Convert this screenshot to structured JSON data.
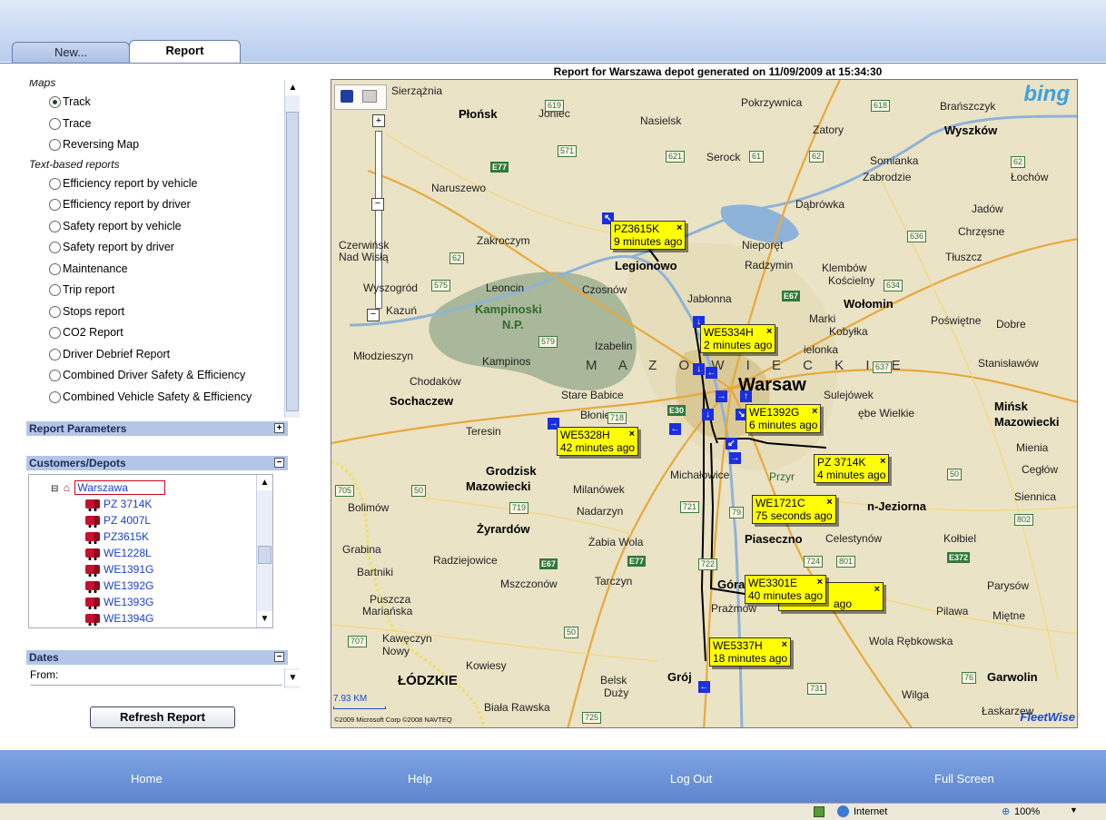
{
  "tabs": [
    {
      "label": "New..."
    },
    {
      "label": "Report"
    }
  ],
  "report_options": {
    "section_maps_label": "Maps",
    "maps": [
      {
        "label": "Track",
        "selected": true
      },
      {
        "label": "Trace",
        "selected": false
      },
      {
        "label": "Reversing Map",
        "selected": false
      }
    ],
    "section_text_label": "Text-based reports",
    "text_reports": [
      {
        "label": "Efficiency report by vehicle"
      },
      {
        "label": "Efficiency report by driver"
      },
      {
        "label": "Safety report by vehicle"
      },
      {
        "label": "Safety report by driver"
      },
      {
        "label": "Maintenance"
      },
      {
        "label": "Trip report"
      },
      {
        "label": "Stops report"
      },
      {
        "label": "CO2 Report"
      },
      {
        "label": "Driver Debrief Report"
      },
      {
        "label": "Combined Driver Safety & Efficiency"
      },
      {
        "label": "Combined Vehicle Safety & Efficiency"
      }
    ]
  },
  "sections": {
    "report_parameters": "Report Parameters",
    "customers_depots": "Customers/Depots",
    "dates": "Dates",
    "from_label": "From:",
    "expand_symbol": "+",
    "collapse_symbol": "−"
  },
  "depot_tree": {
    "depot": "Warszawa",
    "vehicles": [
      "PZ 3714K",
      "PZ 4007L",
      "PZ3615K",
      "WE1228L",
      "WE1391G",
      "WE1392G",
      "WE1393G",
      "WE1394G"
    ]
  },
  "refresh_button": "Refresh Report",
  "map": {
    "title": "Report for Warszawa depot generated on 11/09/2009 at 15:34:30",
    "brand": "bing",
    "footer_brand": "FleetWise",
    "scale": "7.93 KM",
    "copyright": "©2009 Microsoft Corp ©2008 NAVTEQ",
    "callouts": [
      {
        "vehicle": "PZ3615K",
        "time": "9 minutes ago"
      },
      {
        "vehicle": "WE5334H",
        "time": "2 minutes ago"
      },
      {
        "vehicle": "WE1392G",
        "time": "6 minutes ago"
      },
      {
        "vehicle": "WE5328H",
        "time": "42 minutes ago"
      },
      {
        "vehicle": "PZ 3714K",
        "time": "4 minutes ago"
      },
      {
        "vehicle": "WE1721C",
        "time": "75 seconds ago"
      },
      {
        "vehicle": "WE3301E",
        "time": "40 minutes ago"
      },
      {
        "vehicle": "",
        "time": "ago"
      },
      {
        "vehicle": "WE5337H",
        "time": "18 minutes ago"
      }
    ],
    "close_symbol": "×",
    "places": {
      "warsaw": "Warsaw",
      "plonsk": "Płońsk",
      "legionowo": "Legionowo",
      "wolomin": "Wołomin",
      "wyszkow": "Wyszków",
      "sochaczew": "Sochaczew",
      "grodzisk": "Grodzisk",
      "mazowiecki": "Mazowiecki",
      "zyrardow": "Żyrardów",
      "minsk": "Mińsk",
      "minsk2": "Mazowiecki",
      "garwolin": "Garwolin",
      "lodzkie": "ŁÓDZKIE",
      "mazowsze": "M A Z O W I E C K I E",
      "kampinoski": "Kampinoski",
      "np": "N.P.",
      "piaseczno": "Piaseczno",
      "jeziorna": "n-Jeziorna",
      "naruszewo": "Naruszewo",
      "joniec": "Joniec",
      "nasielsk": "Nasielsk",
      "pokrzywnica": "Pokrzywnica",
      "branszczyk": "Brańszczyk",
      "zatory": "Zatory",
      "serock": "Serock",
      "somianka": "Somianka",
      "zabrodzie": "Zabrodzie",
      "lochow": "Łochów",
      "dabrowka": "Dąbrówka",
      "jadow": "Jadów",
      "zakroczym": "Zakroczym",
      "nieporet": "Nieporęt",
      "chrzesne": "Chrzęsne",
      "radzymin": "Radzymin",
      "klembow": "Klembów",
      "koscielny": "Kościelny",
      "tluszcz": "Tłuszcz",
      "czosnow": "Czosnów",
      "leoncin": "Leoncin",
      "jablonna": "Jabłonna",
      "marki": "Marki",
      "kobylka": "Kobyłka",
      "poswietne": "Poświętne",
      "dobre": "Dobre",
      "mlodzieszyn": "Młodzieszyn",
      "izabelin": "Izabelin",
      "kampinos": "Kampinos",
      "zielonka": "ielonka",
      "stanislawow": "Stanisławów",
      "chodakow": "Chodaków",
      "stare_babice": "Stare Babice",
      "sulejowek": "Sulejówek",
      "dziebe": "ębe Wielkie",
      "teresin": "Teresin",
      "plonie": "Błonie",
      "mienia": "Mienia",
      "ceglow": "Cegłów",
      "michalowice": "Michałowice",
      "milanowek": "Milanówek",
      "bolimow": "Bolimów",
      "nadarzyn": "Nadarzyn",
      "siennica": "Siennica",
      "grabina": "Grabina",
      "zabia_wola": "Żabia Wola",
      "kolbiel": "Kołbiel",
      "radziejowice": "Radziejowice",
      "bartniki": "Bartniki",
      "mszczonow": "Mszczonów",
      "tarczyn": "Tarczyn",
      "parysow": "Parysów",
      "puszcza": "Puszcza",
      "marianska": "Mariańska",
      "pilawa": "Pilawa",
      "mietne": "Miętne",
      "kaweczyn": "Kawęczyn",
      "nowy": "Nowy",
      "wola_rebkowska": "Wola Rębkowska",
      "kowiesy": "Kowiesy",
      "belsk": "Belsk",
      "duzy": "Duży",
      "grojec": "Grój",
      "wilga": "Wilga",
      "biala": "Biała Rawska",
      "laskarzew": "Łaskarzew",
      "czerwinsk": "Czerwińsk",
      "nad_wisla": "Nad Wisłą",
      "wyszogrod": "Wyszogród",
      "kazun": "Kazuń",
      "zierzaznia": "Sierzążnia",
      "celestynow": "Celestynów",
      "prazmow": "Prażmów",
      "gora": "Góra",
      "przyrodniczy": "Przyr"
    }
  },
  "footer": {
    "home": "Home",
    "help": "Help",
    "logout": "Log Out",
    "fullscreen": "Full Screen"
  },
  "status_bar": {
    "zone": "Internet",
    "zoom": "100%"
  },
  "colors": {
    "callout": "#ffff00",
    "marker": "#1c2fe0",
    "header_band": "#b3c6e6",
    "footer": "#6b93d6"
  }
}
